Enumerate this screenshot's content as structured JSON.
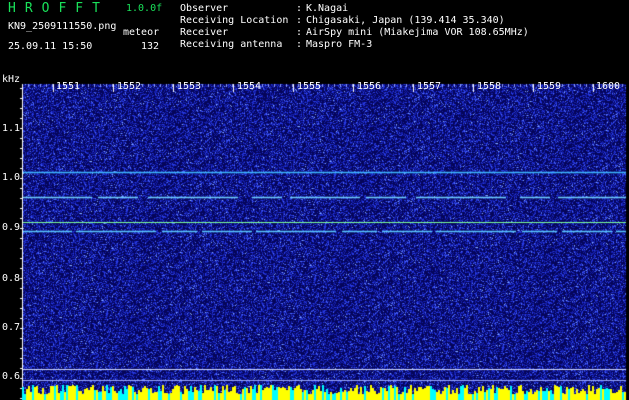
{
  "app": {
    "brand": "HROFFT",
    "version": "1.0.0f"
  },
  "file": {
    "name": "KN9_2509111550.png",
    "datetime": "25.09.11 15:50",
    "meteor_label": "meteor",
    "meteor_count": "132"
  },
  "meta": [
    {
      "label": "Observer",
      "value": "K.Nagai"
    },
    {
      "label": "Receiving Location",
      "value": "Chigasaki, Japan (139.414 35.340)"
    },
    {
      "label": "Receiver",
      "value": "AirSpy mini (Miakejima VOR 108.65MHz)"
    },
    {
      "label": "Receiving antenna",
      "value": "Maspro FM-3"
    }
  ],
  "spectrogram": {
    "unit": "kHz",
    "y_ticks": [
      "1.1",
      "1.0",
      "0.9",
      "0.8",
      "0.7",
      "0.6"
    ],
    "time_ticks": [
      "1551",
      "1552",
      "1553",
      "1554",
      "1555",
      "1556",
      "1557",
      "1558",
      "1559",
      "1600"
    ],
    "bg_color": "#05055a",
    "noise_color": "#2a3cff"
  }
}
